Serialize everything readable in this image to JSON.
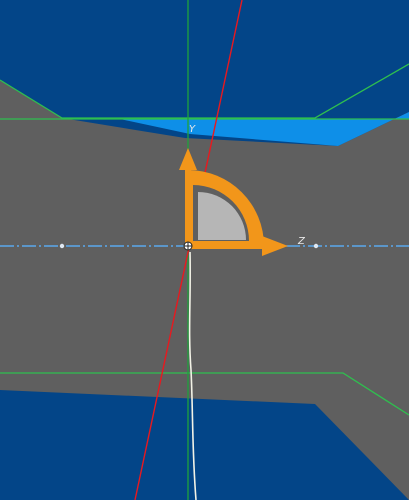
{
  "viewport": {
    "colors": {
      "background": "#034588",
      "model_surface": "#5f5f5f",
      "highlight_face": "#0e8fe8",
      "edge": "#2fbf4f",
      "red_axis": "#e8191f",
      "green_axis": "#1fa23c",
      "blue_axis": "#5aa8ee",
      "white_line": "#f2f2e6",
      "gizmo_orange": "#f2961a",
      "gizmo_arc": "#b6b6b6"
    },
    "gizmo": {
      "horizontal_axis_label": "Z",
      "vertical_axis_label": "Y",
      "handle_icons": [
        "translate-arrow-vertical-icon",
        "translate-arrow-horizontal-icon",
        "rotate-arc-handle-icon",
        "pivot-origin-icon"
      ]
    }
  }
}
